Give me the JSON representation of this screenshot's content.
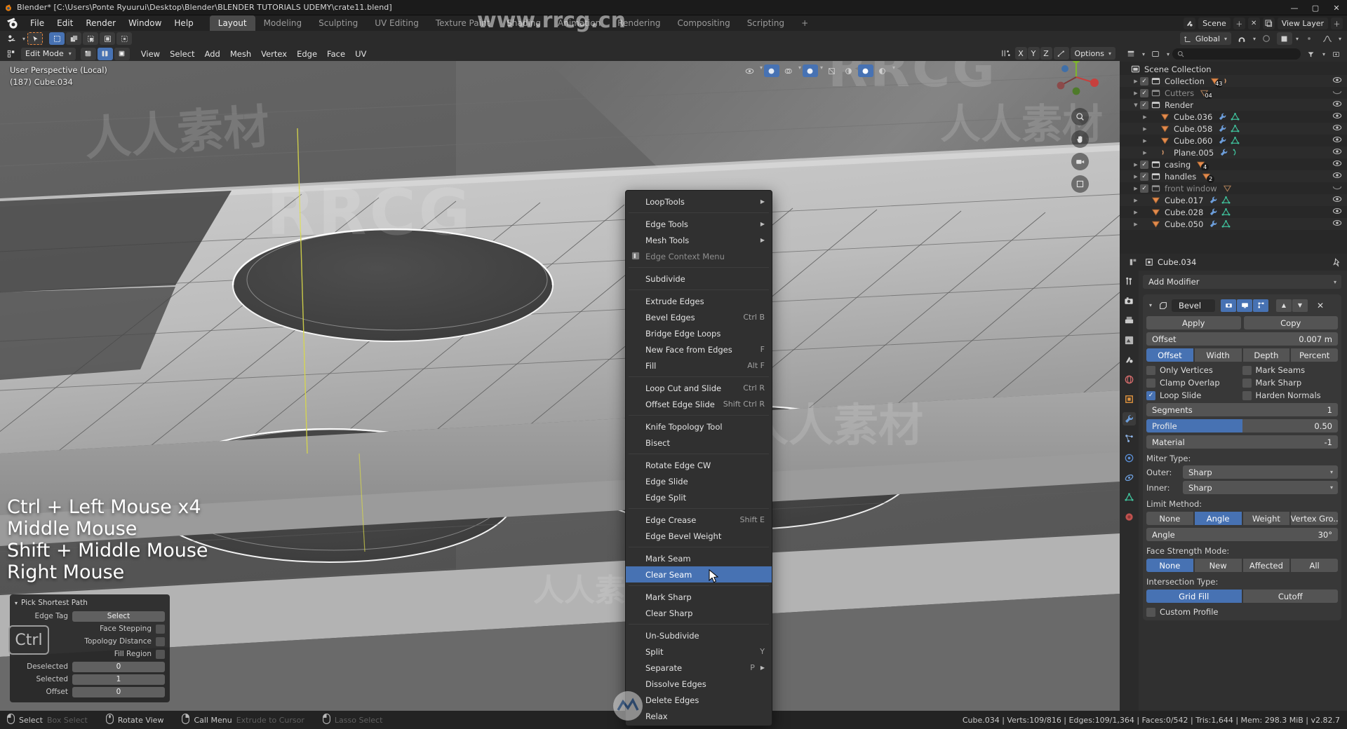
{
  "window": {
    "title": "Blender* [C:\\Users\\Ponte Ryuurui\\Desktop\\Blender\\BLENDER TUTORIALS UDEMY\\crate11.blend]",
    "minimize": "—",
    "maximize": "▢",
    "close": "✕"
  },
  "topbar": {
    "menus": [
      "File",
      "Edit",
      "Render",
      "Window",
      "Help"
    ],
    "workspaces": [
      {
        "label": "Layout",
        "active": true
      },
      {
        "label": "Modeling",
        "active": false
      },
      {
        "label": "Sculpting",
        "active": false
      },
      {
        "label": "UV Editing",
        "active": false
      },
      {
        "label": "Texture Paint",
        "active": false
      },
      {
        "label": "Shading",
        "active": false
      },
      {
        "label": "Animation",
        "active": false
      },
      {
        "label": "Rendering",
        "active": false
      },
      {
        "label": "Compositing",
        "active": false
      },
      {
        "label": "Scripting",
        "active": false
      },
      {
        "label": "+",
        "active": false
      }
    ],
    "scene_name": "Scene",
    "view_layer_name": "View Layer"
  },
  "toolrow": {
    "transform_orientation": "Global",
    "options_label": "Options"
  },
  "viewport": {
    "mode": "Edit Mode",
    "menus": [
      "View",
      "Select",
      "Add",
      "Mesh",
      "Vertex",
      "Edge",
      "Face",
      "UV"
    ],
    "perspective_line1": "User Perspective (Local)",
    "perspective_line2": "(187) Cube.034",
    "axis_labels": [
      "X",
      "Y",
      "Z"
    ],
    "options_label": "Options",
    "keys_overlay": [
      "Ctrl + Left Mouse x4",
      "Middle Mouse",
      "Shift + Middle Mouse",
      "Right Mouse"
    ]
  },
  "redo_panel": {
    "title": "Pick Shortest Path",
    "rows": [
      {
        "label": "Edge Tag",
        "value": "Select",
        "type": "dropdown"
      },
      {
        "label": "Face Stepping",
        "type": "checkbox",
        "checked": false
      },
      {
        "label": "Topology Distance",
        "type": "checkbox",
        "checked": false
      },
      {
        "label": "Fill Region",
        "type": "checkbox",
        "checked": false
      },
      {
        "label": "Deselected",
        "value": "0",
        "type": "field"
      },
      {
        "label": "Selected",
        "value": "1",
        "type": "field"
      },
      {
        "label": "Offset",
        "value": "0",
        "type": "field"
      }
    ],
    "ctrl_key": "Ctrl"
  },
  "context_menu": {
    "items": [
      {
        "label": "LoopTools",
        "shortcut": "",
        "submenu": true,
        "sep_after": true
      },
      {
        "label": "Edge Tools",
        "shortcut": "",
        "submenu": true
      },
      {
        "label": "Mesh Tools",
        "shortcut": "",
        "submenu": true
      },
      {
        "label": "Edge Context Menu",
        "shortcut": "",
        "disabled": true,
        "icon": "panel-icon",
        "sep_after": true
      },
      {
        "label": "Subdivide",
        "shortcut": "",
        "sep_after": true
      },
      {
        "label": "Extrude Edges",
        "shortcut": ""
      },
      {
        "label": "Bevel Edges",
        "shortcut": "Ctrl B"
      },
      {
        "label": "Bridge Edge Loops",
        "shortcut": ""
      },
      {
        "label": "New Face from Edges",
        "shortcut": "F"
      },
      {
        "label": "Fill",
        "shortcut": "Alt F",
        "sep_after": true
      },
      {
        "label": "Loop Cut and Slide",
        "shortcut": "Ctrl R"
      },
      {
        "label": "Offset Edge Slide",
        "shortcut": "Shift Ctrl R",
        "sep_after": true
      },
      {
        "label": "Knife Topology Tool",
        "shortcut": ""
      },
      {
        "label": "Bisect",
        "shortcut": "",
        "sep_after": true
      },
      {
        "label": "Rotate Edge CW",
        "shortcut": ""
      },
      {
        "label": "Edge Slide",
        "shortcut": ""
      },
      {
        "label": "Edge Split",
        "shortcut": "",
        "sep_after": true
      },
      {
        "label": "Edge Crease",
        "shortcut": "Shift E"
      },
      {
        "label": "Edge Bevel Weight",
        "shortcut": "",
        "sep_after": true
      },
      {
        "label": "Mark Seam",
        "shortcut": ""
      },
      {
        "label": "Clear Seam",
        "shortcut": "",
        "selected": true,
        "sep_after": true
      },
      {
        "label": "Mark Sharp",
        "shortcut": ""
      },
      {
        "label": "Clear Sharp",
        "shortcut": "",
        "sep_after": true
      },
      {
        "label": "Un-Subdivide",
        "shortcut": ""
      },
      {
        "label": "Split",
        "shortcut": "Y"
      },
      {
        "label": "Separate",
        "shortcut": "P",
        "submenu": true
      },
      {
        "label": "Dissolve Edges",
        "shortcut": ""
      },
      {
        "label": "Delete Edges",
        "shortcut": ""
      },
      {
        "label": "Relax",
        "shortcut": ""
      }
    ]
  },
  "outliner": {
    "search_placeholder": "",
    "rows": [
      {
        "name": "Scene Collection",
        "indent": 0,
        "type": "scene",
        "checkbox": false,
        "disclosure": "",
        "eye": false,
        "dim": false
      },
      {
        "name": "Collection",
        "indent": 1,
        "type": "collection",
        "checkbox": true,
        "disclosure": "right",
        "eye": true,
        "dim": false,
        "badges": [
          {
            "kind": "mesh",
            "count": "43"
          },
          {
            "kind": "curve",
            "count": ""
          }
        ]
      },
      {
        "name": "Cutters",
        "indent": 1,
        "type": "collection",
        "checkbox": true,
        "disclosure": "right",
        "eye": "closed",
        "dim": true,
        "badges": [
          {
            "kind": "mesh-dim",
            "count": "04"
          }
        ]
      },
      {
        "name": "Render",
        "indent": 1,
        "type": "collection",
        "checkbox": true,
        "disclosure": "down",
        "eye": true,
        "dim": false
      },
      {
        "name": "Cube.036",
        "indent": 2,
        "type": "mesh",
        "checkbox": false,
        "disclosure": "right",
        "eye": true,
        "dim": false,
        "badges": [
          {
            "kind": "wrench",
            "count": ""
          },
          {
            "kind": "tri",
            "count": ""
          }
        ]
      },
      {
        "name": "Cube.058",
        "indent": 2,
        "type": "mesh",
        "checkbox": false,
        "disclosure": "right",
        "eye": true,
        "dim": false,
        "badges": [
          {
            "kind": "wrench",
            "count": ""
          },
          {
            "kind": "tri",
            "count": ""
          }
        ]
      },
      {
        "name": "Cube.060",
        "indent": 2,
        "type": "mesh",
        "checkbox": false,
        "disclosure": "right",
        "eye": true,
        "dim": false,
        "badges": [
          {
            "kind": "wrench",
            "count": ""
          },
          {
            "kind": "tri",
            "count": ""
          }
        ]
      },
      {
        "name": "Plane.005",
        "indent": 2,
        "type": "curve",
        "checkbox": false,
        "disclosure": "right",
        "eye": true,
        "dim": false,
        "badges": [
          {
            "kind": "wrench",
            "count": ""
          },
          {
            "kind": "curve-data",
            "count": ""
          }
        ]
      },
      {
        "name": "casing",
        "indent": 1,
        "type": "collection",
        "checkbox": true,
        "disclosure": "right",
        "eye": true,
        "dim": false,
        "badges": [
          {
            "kind": "mesh",
            "count": "4"
          }
        ]
      },
      {
        "name": "handles",
        "indent": 1,
        "type": "collection",
        "checkbox": true,
        "disclosure": "right",
        "eye": true,
        "dim": false,
        "badges": [
          {
            "kind": "mesh",
            "count": "2"
          }
        ]
      },
      {
        "name": "front window",
        "indent": 1,
        "type": "collection",
        "checkbox": true,
        "disclosure": "right",
        "eye": "closed",
        "dim": true,
        "badges": [
          {
            "kind": "mesh-dim",
            "count": ""
          }
        ]
      },
      {
        "name": "Cube.017",
        "indent": 1,
        "type": "mesh",
        "checkbox": false,
        "disclosure": "right",
        "eye": true,
        "dim": false,
        "badges": [
          {
            "kind": "wrench",
            "count": ""
          },
          {
            "kind": "tri",
            "count": ""
          }
        ]
      },
      {
        "name": "Cube.028",
        "indent": 1,
        "type": "mesh",
        "checkbox": false,
        "disclosure": "right",
        "eye": true,
        "dim": false,
        "badges": [
          {
            "kind": "wrench",
            "count": ""
          },
          {
            "kind": "tri",
            "count": ""
          }
        ]
      },
      {
        "name": "Cube.050",
        "indent": 1,
        "type": "mesh",
        "checkbox": false,
        "disclosure": "right",
        "eye": true,
        "dim": false,
        "badges": [
          {
            "kind": "wrench",
            "count": ""
          },
          {
            "kind": "tri",
            "count": ""
          }
        ]
      }
    ]
  },
  "properties": {
    "object_name": "Cube.034",
    "add_modifier_label": "Add Modifier",
    "modifier": {
      "name": "Bevel",
      "apply_label": "Apply",
      "copy_label": "Copy",
      "offset_label": "Offset",
      "offset_value": "0.007 m",
      "width_type_options": [
        "Offset",
        "Width",
        "Depth",
        "Percent"
      ],
      "width_type_active": "Offset",
      "checkboxes_left": [
        {
          "label": "Only Vertices",
          "checked": false
        },
        {
          "label": "Clamp Overlap",
          "checked": false
        },
        {
          "label": "Loop Slide",
          "checked": true
        }
      ],
      "checkboxes_right": [
        {
          "label": "Mark Seams",
          "checked": false
        },
        {
          "label": "Mark Sharp",
          "checked": false
        },
        {
          "label": "Harden Normals",
          "checked": false
        }
      ],
      "segments_label": "Segments",
      "segments_value": "1",
      "profile_label": "Profile",
      "profile_value": "0.50",
      "profile_fill_pct": 50,
      "material_label": "Material",
      "material_value": "-1",
      "miter_type_label": "Miter Type:",
      "miter_outer_label": "Outer:",
      "miter_outer_value": "Sharp",
      "miter_inner_label": "Inner:",
      "miter_inner_value": "Sharp",
      "limit_method_label": "Limit Method:",
      "limit_method_options": [
        "None",
        "Angle",
        "Weight",
        "Vertex Gro.."
      ],
      "limit_method_active": "Angle",
      "angle_label": "Angle",
      "angle_value": "30°",
      "face_strength_label": "Face Strength Mode:",
      "face_strength_options": [
        "None",
        "New",
        "Affected",
        "All"
      ],
      "face_strength_active": "None",
      "intersection_label": "Intersection Type:",
      "intersection_options": [
        "Grid Fill",
        "Cutoff"
      ],
      "intersection_active": "Grid Fill",
      "custom_profile_label": "Custom Profile",
      "custom_profile_checked": false
    }
  },
  "statusbar": {
    "hints": [
      {
        "mouse": "left",
        "label": "Select",
        "ghost": "Box Select"
      },
      {
        "mouse": "middle",
        "label": "Rotate View",
        "ghost": ""
      },
      {
        "mouse": "right",
        "label": "Call Menu",
        "ghost": "Extrude to Cursor"
      },
      {
        "mouse": "left",
        "label": "",
        "ghost": "Lasso Select"
      }
    ],
    "stats": "Cube.034 | Verts:109/816 | Edges:109/1,364 | Faces:0/542 | Tris:1,644 | Mem: 298.3 MiB | v2.82.7"
  },
  "watermarks": {
    "url": "www.rrcg.cn",
    "brand": "RRCG",
    "cn": "人人素材"
  },
  "colors": {
    "accent": "#4772b3",
    "orange": "#e8863d",
    "panel": "#303030",
    "header": "#2b2b2b"
  }
}
